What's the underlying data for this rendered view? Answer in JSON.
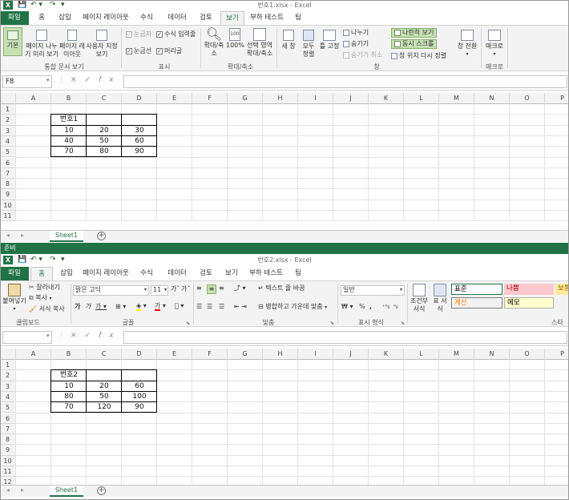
{
  "window1": {
    "title": "번호1.xlsx - Excel",
    "tabs": [
      "파일",
      "홈",
      "삽입",
      "페이지 레이아웃",
      "수식",
      "데이터",
      "검토",
      "보기",
      "부하 테스트",
      "팀"
    ],
    "active_tab": "보기",
    "ribbon": {
      "workbook_views": [
        "기본",
        "페이지 나누기 미리 보기",
        "페이지 레이아웃",
        "사용자 지정 보기"
      ],
      "workbook_views_group": "통합 문서 보기",
      "show": [
        "눈금자",
        "수식 입력줄",
        "눈금선",
        "머리글"
      ],
      "show_group": "표시",
      "zoom": [
        "확대/축소",
        "100%",
        "선택 영역 확대/축소"
      ],
      "zoom_group": "확대/축소",
      "window": [
        "새 창",
        "모두 정렬",
        "틀 고정",
        "나누기",
        "숨기기",
        "숨기기 취소",
        "나란히 보기",
        "동시 스크롤",
        "창 위치 다시 정렬",
        "창 전환"
      ],
      "window_group": "창",
      "macro": "매크로",
      "macro_group": "매크로"
    },
    "namebox": "F8",
    "sheet_tab": "Sheet1",
    "table": {
      "header": "번호1",
      "rows": [
        [
          "10",
          "20",
          "30"
        ],
        [
          "40",
          "50",
          "60"
        ],
        [
          "70",
          "80",
          "90"
        ]
      ]
    }
  },
  "status_text": "준비",
  "window2": {
    "title": "번호2.xlsx - Excel",
    "tabs": [
      "파일",
      "홈",
      "삽입",
      "페이지 레이아웃",
      "수식",
      "데이터",
      "검토",
      "보기",
      "부하 테스트",
      "팀"
    ],
    "active_tab": "홈",
    "ribbon": {
      "paste": "붙여넣기",
      "cut": "잘라내기",
      "copy": "복사",
      "format_painter": "서식 복사",
      "clipboard_group": "클립보드",
      "font_name": "맑은 고딕",
      "font_size": "11",
      "font_group": "글꼴",
      "wrap_text": "텍스트 줄 바꿈",
      "merge_center": "병합하고 가운데 맞춤",
      "align_group": "맞춤",
      "number_format": "일반",
      "number_group": "표시 형식",
      "cond_format": "조건부 서식",
      "table_format": "표 서식",
      "styles": [
        {
          "label": "표준",
          "bg": "#ffffff",
          "color": "#000000"
        },
        {
          "label": "나쁨",
          "bg": "#ffc7ce",
          "color": "#9c0006"
        },
        {
          "label": "보통",
          "bg": "#ffeb9c",
          "color": "#9c6500"
        },
        {
          "label": "계산",
          "bg": "#f2f2f2",
          "color": "#fa7d00"
        },
        {
          "label": "메모",
          "bg": "#ffffcc",
          "color": "#000000"
        }
      ],
      "styles_group": "스타"
    },
    "namebox": "",
    "sheet_tab": "Sheet1",
    "table": {
      "header": "번호2",
      "rows": [
        [
          "10",
          "20",
          "60"
        ],
        [
          "80",
          "50",
          "100"
        ],
        [
          "70",
          "120",
          "90"
        ]
      ]
    }
  },
  "columns": [
    "A",
    "B",
    "C",
    "D",
    "E",
    "F",
    "G",
    "H",
    "I",
    "J",
    "K",
    "L",
    "M",
    "N",
    "O",
    "P"
  ],
  "rows1": [
    "1",
    "2",
    "3",
    "4",
    "5",
    "6",
    "7",
    "8",
    "9",
    "10",
    "11"
  ],
  "rows2": [
    "1",
    "2",
    "3",
    "4",
    "5",
    "6",
    "7",
    "8",
    "9",
    "10",
    "11",
    "12"
  ],
  "accent": "#217346"
}
